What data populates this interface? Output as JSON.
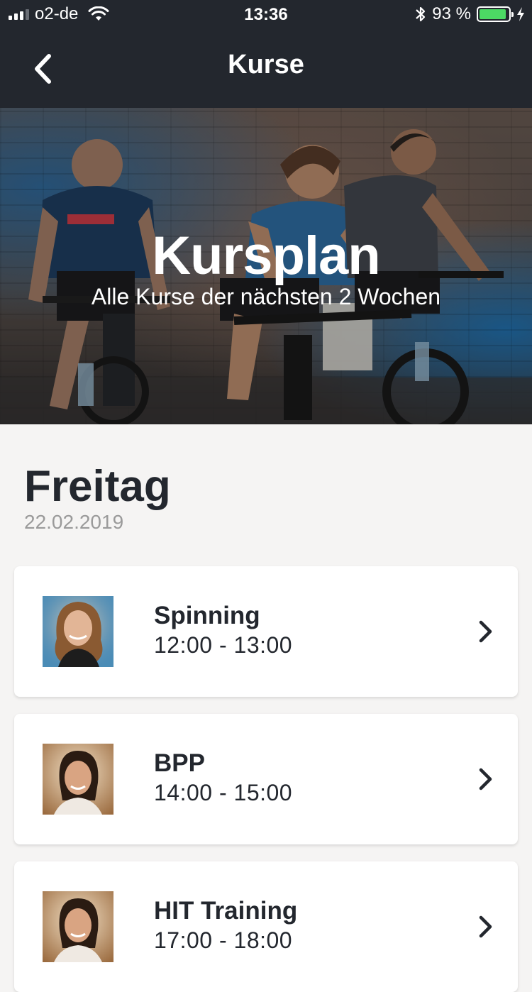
{
  "status_bar": {
    "carrier": "o2-de",
    "time": "13:36",
    "battery_text": "93 %",
    "battery_level": 0.93,
    "icons": [
      "signal-icon",
      "wifi-icon",
      "bluetooth-icon",
      "battery-icon",
      "charging-icon"
    ]
  },
  "nav": {
    "title": "Kurse",
    "back_icon": "chevron-left-icon"
  },
  "hero": {
    "title": "Kursplan",
    "subtitle": "Alle Kurse der nächsten 2 Wochen"
  },
  "day": {
    "name": "Freitag",
    "date": "22.02.2019"
  },
  "courses": [
    {
      "name": "Spinning",
      "time": "12:00 - 13:00"
    },
    {
      "name": "BPP",
      "time": "14:00 - 15:00"
    },
    {
      "name": "HIT Training",
      "time": "17:00 - 18:00"
    }
  ],
  "colors": {
    "header_bg": "#23272e",
    "page_bg": "#f5f4f3",
    "card_bg": "#ffffff",
    "text_dark": "#23272e",
    "date_gray": "#9a9a9a",
    "battery_green": "#4cd964"
  }
}
